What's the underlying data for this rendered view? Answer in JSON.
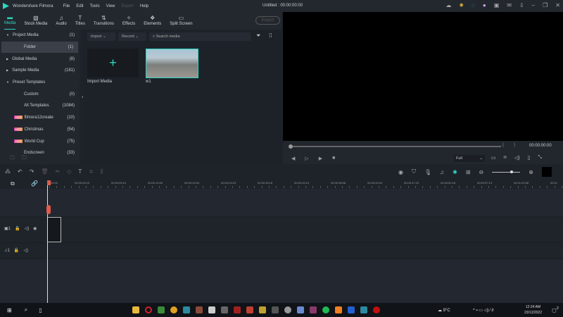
{
  "app": {
    "title": "Wondershare Filmora",
    "project_title": "Untitled : 00:00:00:00",
    "menu": [
      "File",
      "Edit",
      "Tools",
      "View",
      "Export",
      "Help"
    ],
    "disabled_menu": "Export"
  },
  "tabs": [
    {
      "label": "Media",
      "icon": "folder-icon"
    },
    {
      "label": "Stock Media",
      "icon": "image-icon"
    },
    {
      "label": "Audio",
      "icon": "music-icon"
    },
    {
      "label": "Titles",
      "icon": "text-icon"
    },
    {
      "label": "Transitions",
      "icon": "transition-icon"
    },
    {
      "label": "Effects",
      "icon": "effects-icon"
    },
    {
      "label": "Elements",
      "icon": "elements-icon"
    },
    {
      "label": "Split Screen",
      "icon": "split-screen-icon"
    }
  ],
  "export_label": "Export",
  "sidebar": [
    {
      "label": "Project Media",
      "count": "(1)",
      "arrow": "▼"
    },
    {
      "label": "Folder",
      "count": "(1)",
      "selected": true
    },
    {
      "label": "Global Media",
      "count": "(8)",
      "arrow": "▶"
    },
    {
      "label": "Sample Media",
      "count": "(181)",
      "arrow": "▶"
    },
    {
      "label": "Preset Templates",
      "count": "",
      "arrow": "▼"
    },
    {
      "label": "Custom",
      "count": "(0)",
      "sub": true
    },
    {
      "label": "All Templates",
      "count": "(1084)",
      "sub": true
    },
    {
      "label": "filmora12create",
      "count": "(10)",
      "hot": "HOT"
    },
    {
      "label": "Christmas",
      "count": "(54)",
      "hot": "HOT"
    },
    {
      "label": "World Cup",
      "count": "(75)",
      "hot": "HOT"
    },
    {
      "label": "Endscreen",
      "count": "(33)",
      "sub": true
    }
  ],
  "media": {
    "import_dd": "Import",
    "record_dd": "Record",
    "search_placeholder": "Search media",
    "import_label": "Import Media",
    "clip_label": "w1"
  },
  "preview": {
    "timecode": "00:00:00:00",
    "quality": "Full",
    "mark_in": "{",
    "mark_out": "}"
  },
  "ruler": [
    "00:00",
    "00:00:04:19",
    "00:00:09:14",
    "00:00:14:09",
    "00:00:19:04",
    "00:00:23:23",
    "00:00:28:18",
    "00:00:33:13",
    "00:00:38:08",
    "00:00:43:04",
    "00:00:47:23",
    "00:00:52:18",
    "00:00:57:13",
    "00:01:02:08",
    "00:01"
  ],
  "tracks": {
    "video_label": "1",
    "audio_label": "1"
  },
  "taskbar": {
    "weather": "9°C",
    "time": "12:24 AM",
    "date": "23/12/2022",
    "notif": "2"
  },
  "colors": {
    "accent": "#2fd6c0",
    "playhead": "#e05a4a"
  }
}
